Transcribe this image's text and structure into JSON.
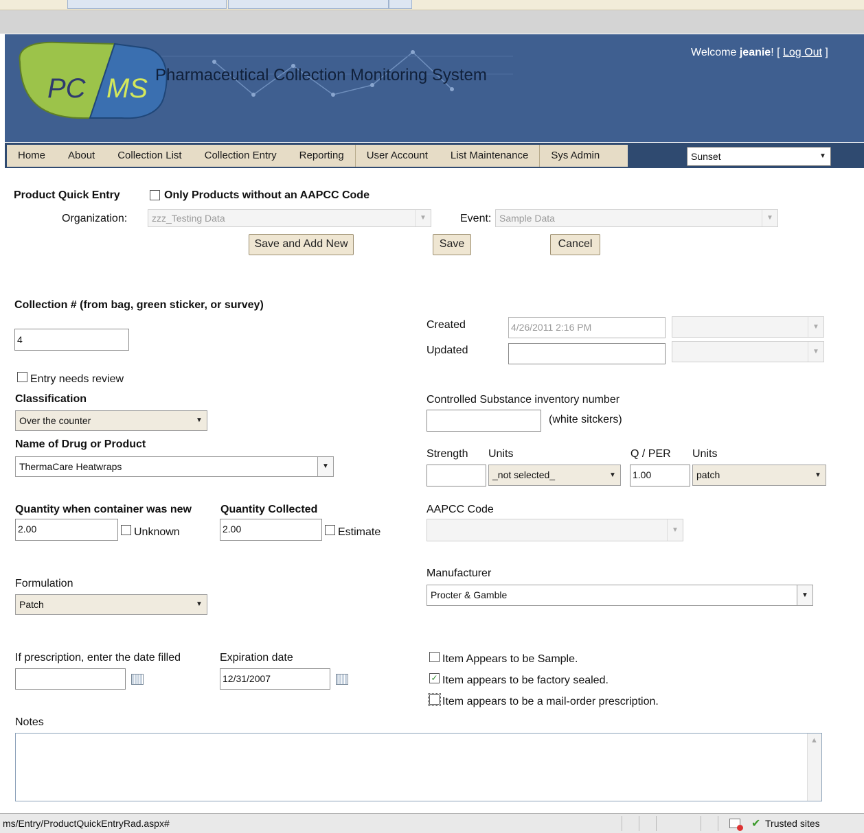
{
  "colors": {
    "header_bg": "#3f5f90",
    "nav_bg": "#2f4a70",
    "menu_bg": "#e6dcc6",
    "button_bg": "#efe6d2"
  },
  "header": {
    "logo_left": "PC",
    "logo_right": "MS",
    "title": "Pharmaceutical Collection Monitoring System",
    "welcome_prefix": "Welcome ",
    "user": "jeanie",
    "welcome_suffix": "! [ ",
    "logout": "Log Out",
    "logout_close": " ]"
  },
  "nav": {
    "items": [
      "Home",
      "About",
      "Collection List",
      "Collection Entry",
      "Reporting",
      "User Account",
      "List Maintenance",
      "Sys Admin"
    ],
    "skin": "Sunset"
  },
  "quick_entry": {
    "title": "Product Quick Entry",
    "only_without_aapcc": "Only Products without an AAPCC Code",
    "org_label": "Organization:",
    "org_value": "zzz_Testing Data",
    "event_label": "Event:",
    "event_value": "Sample Data",
    "save_add_new": "Save and Add New",
    "save": "Save",
    "cancel": "Cancel"
  },
  "form": {
    "collection_label": "Collection # (from bag, green sticker, or survey)",
    "collection_value": "4",
    "created_label": "Created",
    "created_value": "4/26/2011 2:16 PM",
    "updated_label": "Updated",
    "needs_review": "Entry needs review",
    "classification_label": "Classification",
    "classification_value": "Over the counter",
    "cs_label": "Controlled Substance inventory number",
    "cs_hint": "(white sitckers)",
    "drug_label": "Name of Drug or Product",
    "drug_value": "ThermaCare Heatwraps",
    "strength_label": "Strength",
    "units_label": "Units",
    "units_value": "_not selected_",
    "qper_label": "Q / PER",
    "qper_value": "1.00",
    "units2_label": "Units",
    "units2_value": "patch",
    "qty_new_label": "Quantity when container was new",
    "qty_new_value": "2.00",
    "unknown": "Unknown",
    "qty_collected_label": "Quantity Collected",
    "qty_collected_value": "2.00",
    "estimate": "Estimate",
    "aapcc_label": "AAPCC Code",
    "formulation_label": "Formulation",
    "formulation_value": "Patch",
    "manufacturer_label": "Manufacturer",
    "manufacturer_value": "Procter & Gamble",
    "rx_date_label": "If prescription, enter the date filled",
    "exp_label": "Expiration date",
    "exp_value": "12/31/2007",
    "sample": "Item Appears to be Sample.",
    "factory_sealed": "Item appears to be factory sealed.",
    "mail_order": "Item appears to be a mail-order prescription.",
    "check_mark": "✓",
    "notes_label": "Notes"
  },
  "status": {
    "url": "ms/Entry/ProductQuickEntryRad.aspx#",
    "zone": "Trusted sites"
  }
}
